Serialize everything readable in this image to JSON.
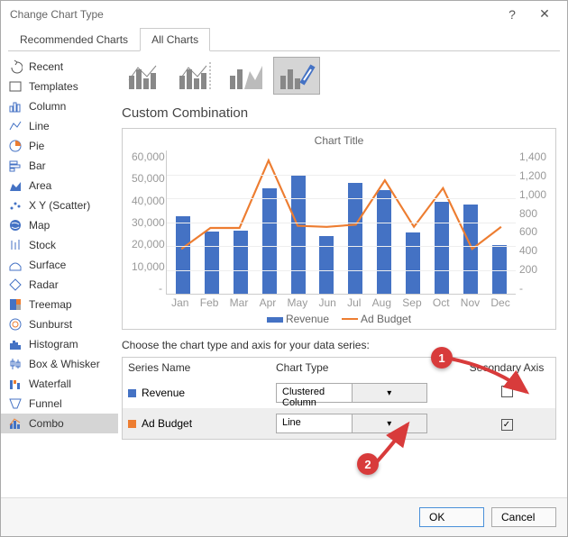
{
  "dialog": {
    "title": "Change Chart Type",
    "ok": "OK",
    "cancel": "Cancel"
  },
  "tabs": {
    "recommended": "Recommended Charts",
    "all": "All Charts"
  },
  "sidebar": {
    "items": [
      {
        "label": "Recent"
      },
      {
        "label": "Templates"
      },
      {
        "label": "Column"
      },
      {
        "label": "Line"
      },
      {
        "label": "Pie"
      },
      {
        "label": "Bar"
      },
      {
        "label": "Area"
      },
      {
        "label": "X Y (Scatter)"
      },
      {
        "label": "Map"
      },
      {
        "label": "Stock"
      },
      {
        "label": "Surface"
      },
      {
        "label": "Radar"
      },
      {
        "label": "Treemap"
      },
      {
        "label": "Sunburst"
      },
      {
        "label": "Histogram"
      },
      {
        "label": "Box & Whisker"
      },
      {
        "label": "Waterfall"
      },
      {
        "label": "Funnel"
      },
      {
        "label": "Combo"
      }
    ]
  },
  "heading": "Custom Combination",
  "preview": {
    "title": "Chart Title",
    "legend": {
      "revenue": "Revenue",
      "adbudget": "Ad Budget"
    }
  },
  "choose_label": "Choose the chart type and axis for your data series:",
  "series_header": {
    "name": "Series Name",
    "type": "Chart Type",
    "secondary": "Secondary Axis"
  },
  "series": [
    {
      "name": "Revenue",
      "color": "#4472c4",
      "type": "Clustered Column",
      "secondary": false
    },
    {
      "name": "Ad Budget",
      "color": "#ed7d31",
      "type": "Line",
      "secondary": true
    }
  ],
  "annotations": {
    "badge1": "1",
    "badge2": "2"
  },
  "chart_data": {
    "type": "combo",
    "title": "Chart Title",
    "categories": [
      "Jan",
      "Feb",
      "Mar",
      "Apr",
      "May",
      "Jun",
      "Jul",
      "Aug",
      "Sep",
      "Oct",
      "Nov",
      "Dec"
    ],
    "series": [
      {
        "name": "Revenue",
        "axis": "primary",
        "type": "bar",
        "values": [
          32500,
          26000,
          26500,
          44000,
          50000,
          24000,
          46500,
          43500,
          25500,
          38500,
          37500,
          20500
        ]
      },
      {
        "name": "Ad Budget",
        "axis": "secondary",
        "type": "line",
        "values": [
          510,
          700,
          700,
          1310,
          720,
          710,
          730,
          1130,
          710,
          1060,
          510,
          710
        ]
      }
    ],
    "y_primary": {
      "min": 0,
      "max": 60000,
      "step": 10000,
      "ticks": [
        "60,000",
        "50,000",
        "40,000",
        "30,000",
        "20,000",
        "10,000",
        "-"
      ]
    },
    "y_secondary": {
      "min": 0,
      "max": 1400,
      "step": 200,
      "ticks": [
        "1,400",
        "1,200",
        "1,000",
        "800",
        "600",
        "400",
        "200",
        "-"
      ]
    }
  }
}
